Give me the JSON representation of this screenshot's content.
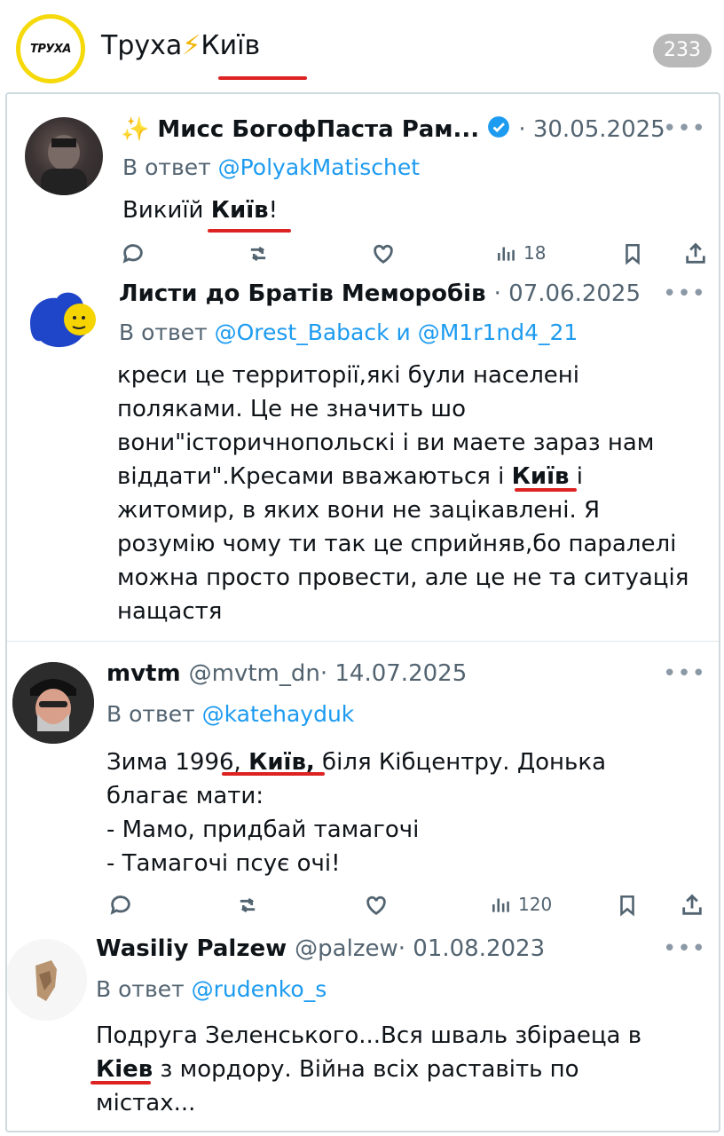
{
  "channel": {
    "logo_text": "ТРУХА",
    "title_part1": "Труха",
    "title_bolt": "⚡",
    "title_part2": "Київ",
    "count": "233"
  },
  "tweets": [
    {
      "name": "✨ Мисс БогофПаста Рам...",
      "date": "· 30.05.2025",
      "reply_prefix": "В ответ ",
      "reply_handle": "@PolyakMatischet",
      "text_before": "Викиїй ",
      "highlight": "Київ",
      "text_after": "!",
      "views": "18"
    },
    {
      "name": "Листи до Братів Меморобів",
      "date": "· 07.06.2025",
      "reply_prefix": "В ответ ",
      "reply_handle": "@Orest_Baback и @M1r1nd4_21",
      "lines": [
        "креси це территорії,які були населені",
        "поляками. Це не значить шо",
        "вони\"історичнопольскі і ви маете зараз нам",
        "віддати\".Кресами вважаються і ",
        "житомир, в яких вони не зацікавлені. Я",
        "розумію чому ти так це сприйняв,бо паралелі",
        "можна просто провести, але це не та ситуація",
        "нащастя"
      ],
      "highlight": "Київ",
      "line4_after": " і"
    },
    {
      "name": "mvtm",
      "handle": "@mvtm_dn",
      "date": "· 14.07.2025",
      "reply_prefix": "В ответ ",
      "reply_handle": "@katehayduk",
      "line1_before": "Зима 1996, ",
      "highlight": "Київ,",
      "line1_after": " біля Кібцентру. Донька",
      "lines": [
        "благає мати:",
        "- Мамо, придбай тамагочі",
        "- Тамагочі псує очі!"
      ],
      "views": "120"
    },
    {
      "name": "Wasiliy Palzew",
      "handle": "@palzew",
      "date": "· 01.08.2023",
      "reply_prefix": "В ответ ",
      "reply_handle": "@rudenko_s",
      "line1": "Подруга Зеленського...Вся шваль збіраеца в",
      "highlight": "Кіев",
      "line2_after": " з мордору. Війна всіх раставіть по",
      "line3": "містах..."
    }
  ],
  "more_label": "•••",
  "colors": {
    "accent": "#1d9bf0",
    "underline": "#dd2222",
    "logo_ring": "#f5d90a"
  }
}
